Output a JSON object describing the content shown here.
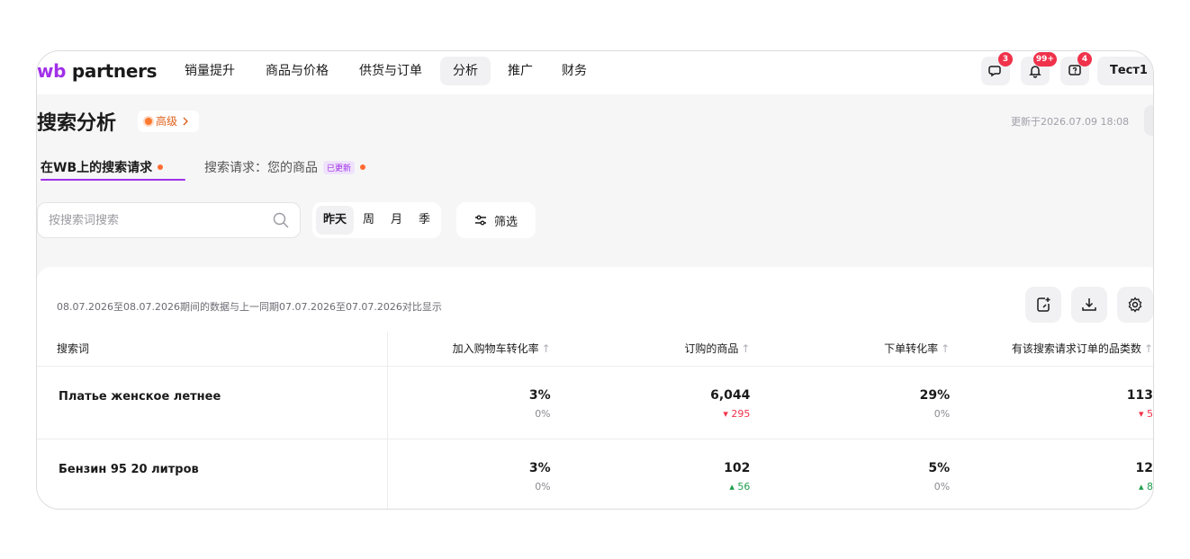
{
  "nav": {
    "logo_wb": "wb",
    "logo_text": " partners",
    "items": [
      {
        "label": "销量提升"
      },
      {
        "label": "商品与价格"
      },
      {
        "label": "供货与订单"
      },
      {
        "label": "分析",
        "active": true
      },
      {
        "label": "推广"
      },
      {
        "label": "财务"
      }
    ],
    "badges": {
      "chat": "3",
      "notifications": "99+",
      "help": "4"
    },
    "user": "Тест1"
  },
  "header": {
    "title": "搜索分析",
    "pro_label": "高级",
    "updated": "更新于2026.07.09 18:08"
  },
  "tabs": [
    {
      "label": "在WB上的搜索请求",
      "active": true
    },
    {
      "label": "搜索请求：您的商品",
      "tag": "已更新"
    }
  ],
  "filters": {
    "search_placeholder": "按搜索词搜索",
    "periods": [
      {
        "label": "昨天",
        "active": true
      },
      {
        "label": "周"
      },
      {
        "label": "月"
      },
      {
        "label": "季"
      }
    ],
    "filter_label": "筛选"
  },
  "table": {
    "note": "08.07.2026至08.07.2026期间的数据与上一同期07.07.2026至07.07.2026对比显示",
    "columns": [
      "搜索词",
      "加入购物车转化率",
      "订购的商品",
      "下单转化率",
      "有该搜索请求订单的品类数"
    ],
    "rows": [
      {
        "term": "Платье женское летнее",
        "cells": [
          {
            "value": "3%",
            "delta": "0%",
            "trend": "none"
          },
          {
            "value": "6,044",
            "delta": "295",
            "trend": "down"
          },
          {
            "value": "29%",
            "delta": "0%",
            "trend": "none"
          },
          {
            "value": "113",
            "delta": "5",
            "trend": "down"
          }
        ]
      },
      {
        "term": "Бензин 95 20 литров",
        "cells": [
          {
            "value": "3%",
            "delta": "0%",
            "trend": "none"
          },
          {
            "value": "102",
            "delta": "56",
            "trend": "up"
          },
          {
            "value": "5%",
            "delta": "0%",
            "trend": "none"
          },
          {
            "value": "12",
            "delta": "8",
            "trend": "up"
          }
        ]
      }
    ]
  }
}
